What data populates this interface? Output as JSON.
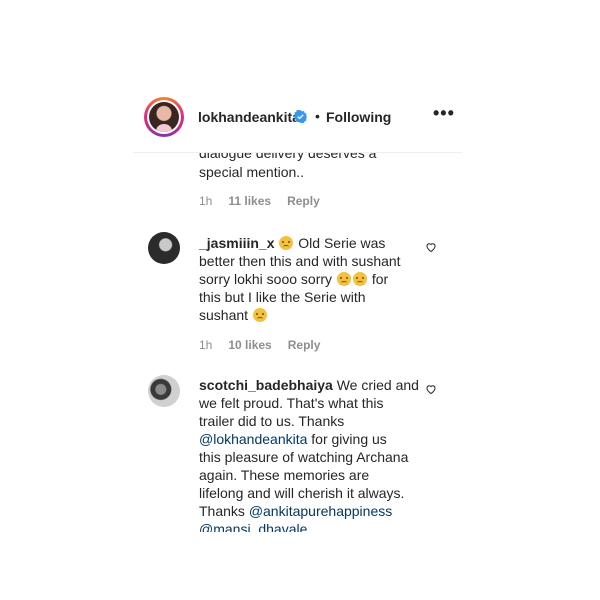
{
  "header": {
    "username": "lokhandeankita",
    "separator": "•",
    "follow_status": "Following",
    "more_label": "•••"
  },
  "comments": [
    {
      "text_line1": "dialogue delivery deserves a",
      "text_line2": "special mention..",
      "time": "1h",
      "likes": "11 likes",
      "reply": "Reply"
    },
    {
      "username": "_jasmiiin_x",
      "seg1": " Old Serie was",
      "line2": "better then this and with sushant",
      "line3a": "sorry lokhi sooo sorry",
      "line3b": " for",
      "line4": "this but I like the Serie with",
      "line5": "sushant",
      "time": "1h",
      "likes": "10 likes",
      "reply": "Reply"
    },
    {
      "username": "scotchi_badebhaiya",
      "line1": " We cried and",
      "line2": "we felt proud. That's what this",
      "line3": "trailer did to us. Thanks",
      "mention1": "@lokhandeankita",
      "line4b": " for giving us",
      "line5": "this pleasure of watching Archana",
      "line6": "again. These memories are",
      "line7": "lifelong and will cherish it always.",
      "line8a": "Thanks ",
      "mention2": "@ankitapurehappiness",
      "mention3": "@mansi_dhavale"
    }
  ],
  "icons": [
    "verified-badge-icon",
    "heart-icon",
    "sad-face-emoji"
  ],
  "colors": {
    "link": "#00376b",
    "verified": "#3897f0",
    "muted": "#8e8e8e"
  }
}
